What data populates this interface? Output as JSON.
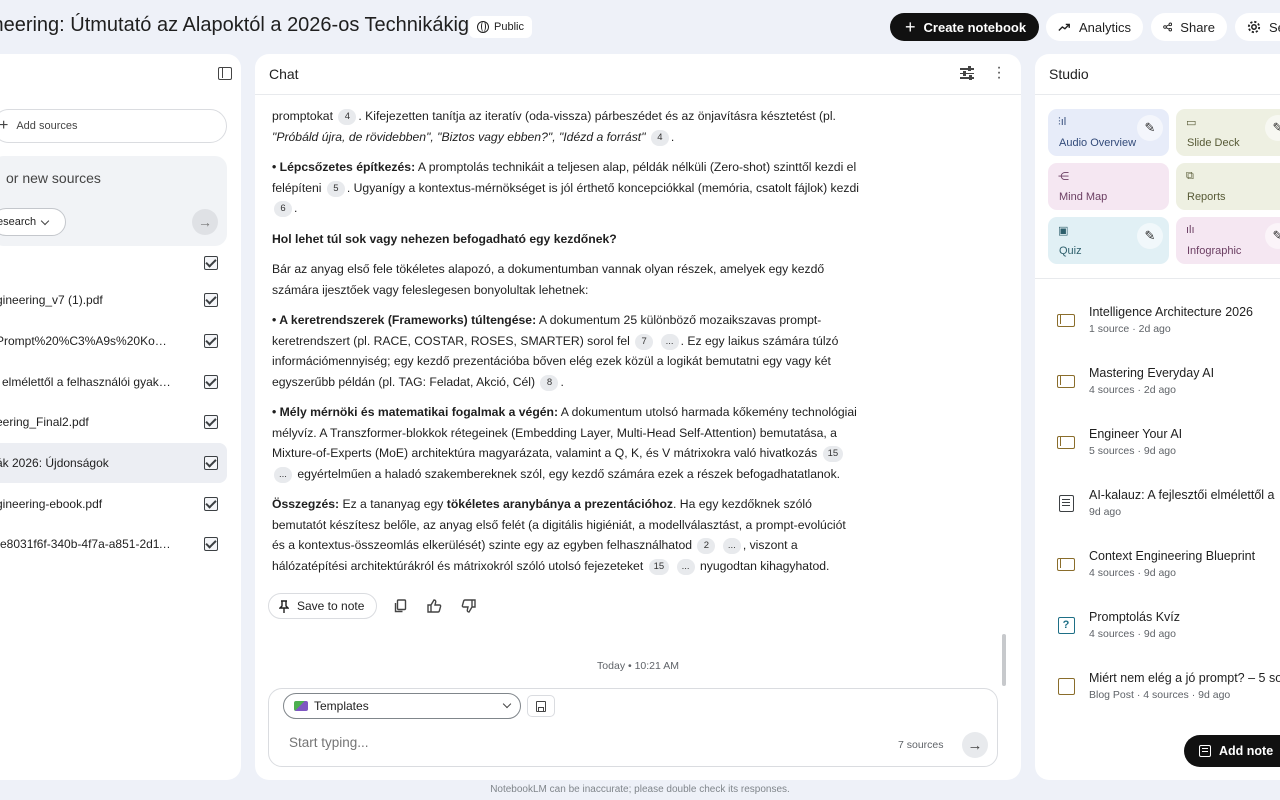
{
  "header": {
    "notebook_title": "ineering: Útmutató az Alapoktól a 2026-os Technikákig",
    "visibility": "Public",
    "create_label": "Create notebook",
    "analytics_label": "Analytics",
    "share_label": "Share",
    "settings_label": "Set"
  },
  "sources": {
    "add_label": "Add sources",
    "search_placeholder": "or new sources",
    "research_label": "esearch",
    "items": [
      {
        "label": "gineering_v7 (1).pdf"
      },
      {
        "label": "Prompt%20%C3%A9s%20Kontext..."
      },
      {
        "label": "i elmélettől a felhasználói gyakorla..."
      },
      {
        "label": "eering_Final2.pdf"
      },
      {
        "label": "ák 2026: Újdonságok"
      },
      {
        "label": "gineering-ebook.pdf"
      },
      {
        "label": "-e8031f6f-340b-4f7a-a851-2d11d..."
      }
    ]
  },
  "chat": {
    "title": "Chat",
    "paragraphs": {
      "p1_a": "promptokat",
      "p1_b": ". Kifejezetten tanítja az iteratív (oda-vissza) párbeszédet és az önjavításra késztetést (pl.",
      "p1_quote": "\"Próbáld újra, de rövidebben\", \"Biztos vagy ebben?\", \"Idézd a forrást\"",
      "p1_c": ".",
      "p2_bold": "• Lépcsőzetes építkezés:",
      "p2_a": " A promptolás technikáit a teljesen alap, példák nélküli (Zero-shot) szinttől kezdi el felépíteni",
      "p2_b": ". Ugyanígy a kontextus-mérnökséget is jól érthető koncepciókkal (memória, csatolt fájlok) kezdi",
      "p2_c": ".",
      "h1": "Hol lehet túl sok vagy nehezen befogadható egy kezdőnek?",
      "p3": "Bár az anyag első fele tökéletes alapozó, a dokumentumban vannak olyan részek, amelyek egy kezdő számára ijesztőek vagy feleslegesen bonyolultak lehetnek:",
      "p4_bold": "• A keretrendszerek (Frameworks) túltengése:",
      "p4_a": " A dokumentum 25 különböző mozaikszavas prompt-keretrendszert (pl. RACE, COSTAR, ROSES, SMARTER) sorol fel",
      "p4_b": ". Ez egy laikus számára túlzó információmennyiség; egy kezdő prezentációba bőven elég ezek közül a logikát bemutatni egy vagy két egyszerűbb példán (pl. TAG: Feladat, Akció, Cél)",
      "p4_c": ".",
      "p5_bold": "• Mély mérnöki és matematikai fogalmak a végén:",
      "p5_a": " A dokumentum utolsó harmada kőkemény technológiai mélyvíz. A Transzformer-blokkok rétegeinek (Embedding Layer, Multi-Head Self-Attention) bemutatása, a Mixture-of-Experts (MoE) architektúra magyarázata, valamint a Q, K, és V mátrixokra való hivatkozás",
      "p5_b": " egyértelműen a haladó szakembereknek szól, egy kezdő számára ezek a részek befogadhatatlanok.",
      "p6_bold": "Összegzés:",
      "p6_a": " Ez a tananyag egy ",
      "p6_bold2": "tökéletes aranybánya a prezentációhoz",
      "p6_b": ". Ha egy kezdőknek szóló bemutatót készítesz belőle, az anyag első felét (a digitális higiéniát, a modellválasztást, a prompt-evolúciót és a kontextus-összeomlás elkerülését) szinte egy az egyben felhasználhatod",
      "p6_c": ", viszont a hálózatépítési architektúrákról és mátrixokról szóló utolsó fejezeteket",
      "p6_d": " nyugodtan kihagyhatod."
    },
    "citations": {
      "c4a": "4",
      "c4b": "4",
      "c5": "5",
      "c6": "6",
      "c7": "7",
      "c8": "8",
      "c15a": "15",
      "c15b": "15",
      "c2": "2",
      "more": "..."
    },
    "save_note_label": "Save to note",
    "timestamp": "Today • 10:21 AM",
    "templates_label": "Templates",
    "input_placeholder": "Start typing...",
    "source_count": "7 sources"
  },
  "studio": {
    "title": "Studio",
    "tiles": [
      {
        "label": "Audio Overview",
        "icon": "audio-waveform-icon"
      },
      {
        "label": "Slide Deck",
        "icon": "slides-icon"
      },
      {
        "label": "Mind Map",
        "icon": "mind-map-icon"
      },
      {
        "label": "Reports",
        "icon": "reports-icon"
      },
      {
        "label": "Quiz",
        "icon": "quiz-icon"
      },
      {
        "label": "Infographic",
        "icon": "infographic-icon"
      }
    ],
    "notes": [
      {
        "title": "Intelligence Architecture 2026",
        "meta": "1 source · 2d ago",
        "icon": "notebook-icon"
      },
      {
        "title": "Mastering Everyday AI",
        "meta": "4 sources · 2d ago",
        "icon": "notebook-icon"
      },
      {
        "title": "Engineer Your AI",
        "meta": "5 sources · 9d ago",
        "icon": "notebook-icon"
      },
      {
        "title": "AI-kalauz: A fejlesztői elmélettől a",
        "meta": "9d ago",
        "icon": "document-icon"
      },
      {
        "title": "Context Engineering Blueprint",
        "meta": "4 sources · 9d ago",
        "icon": "notebook-icon"
      },
      {
        "title": "Promptolás Kvíz",
        "meta": "4 sources · 9d ago",
        "icon": "quiz-icon"
      },
      {
        "title": "Miért nem elég a jó prompt? – 5 so",
        "meta": "Blog Post · 4 sources · 9d ago",
        "icon": "blog-post-icon"
      }
    ],
    "add_note_label": "Add note"
  },
  "footer": {
    "disclaimer": "NotebookLM can be inaccurate; please double check its responses."
  }
}
